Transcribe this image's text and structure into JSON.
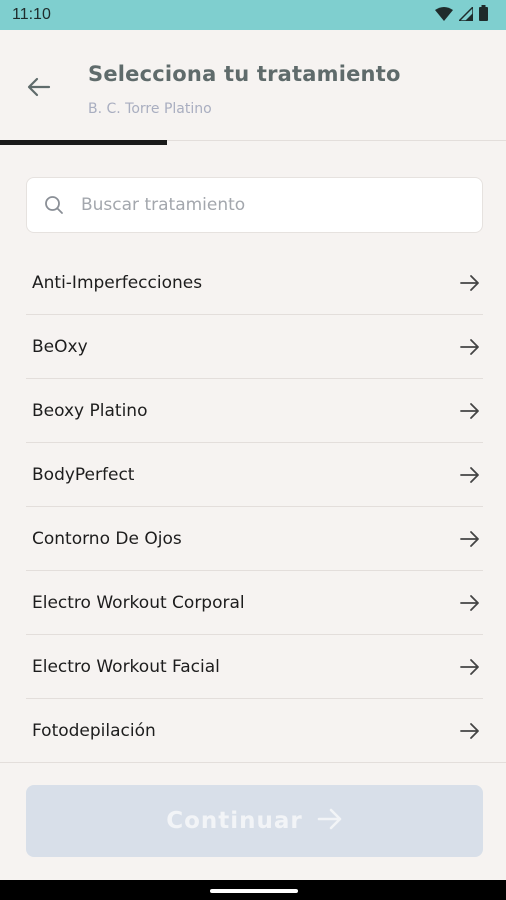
{
  "status_bar": {
    "time": "11:10",
    "icons": [
      "wifi-icon",
      "signal-icon",
      "battery-icon"
    ]
  },
  "header": {
    "back_icon": "arrow-left-icon",
    "title": "Selecciona tu tratamiento",
    "subtitle": "B. C. Torre Platino"
  },
  "progress": {
    "value_fraction": 0.33
  },
  "search": {
    "icon": "search-icon",
    "placeholder": "Buscar tratamiento",
    "value": ""
  },
  "treatments": [
    {
      "label": "Anti-Imperfecciones"
    },
    {
      "label": "BeOxy"
    },
    {
      "label": "Beoxy Platino"
    },
    {
      "label": "BodyPerfect"
    },
    {
      "label": "Contorno De Ojos"
    },
    {
      "label": "Electro Workout Corporal"
    },
    {
      "label": "Electro Workout Facial"
    },
    {
      "label": "Fotodepilación"
    }
  ],
  "footer": {
    "continue_label": "Continuar",
    "continue_icon": "arrow-right-icon"
  },
  "colors": {
    "status_bar_bg": "#7fcfcf",
    "background": "#f6f3f1",
    "title": "#5f6b6b",
    "subtitle": "#a9aec0",
    "button_disabled": "#d8dfe9"
  }
}
